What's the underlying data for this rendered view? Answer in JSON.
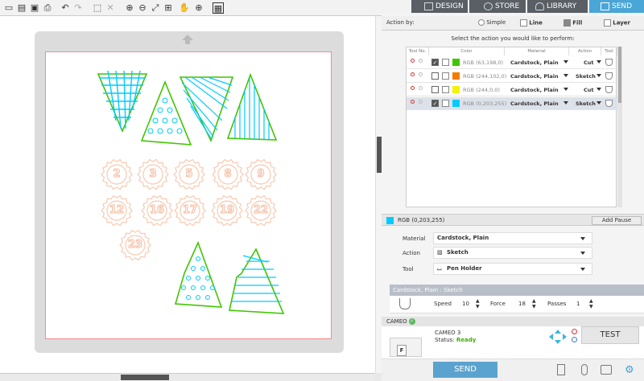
{
  "nav": {
    "design": "DESIGN",
    "store": "STORE",
    "library": "LIBRARY",
    "send": "SEND"
  },
  "action_bar": {
    "label": "Action by:",
    "simple": "Simple",
    "line": "Line",
    "fill": "Fill",
    "layer": "Layer"
  },
  "instruction": "Select the action you would like to perform:",
  "table": {
    "headers": [
      "Tool No.",
      "Color",
      "Material",
      "Action",
      "Tool"
    ],
    "rows": [
      {
        "checked": true,
        "swatch": "#3fc600",
        "color": "RGB (63,198,0)",
        "material": "Cardstock, Plain",
        "action": "Cut",
        "selected": false
      },
      {
        "checked": false,
        "swatch": "#f47a00",
        "color": "RGB (244,102,0)",
        "material": "Cardstock, Plain",
        "action": "Sketch",
        "selected": false
      },
      {
        "checked": false,
        "swatch": "#f4f400",
        "color": "RGB (244,0,0)",
        "material": "Cardstock, Plain",
        "action": "Cut",
        "selected": false
      },
      {
        "checked": true,
        "swatch": "#00cbff",
        "color": "RGB (0,203,255)",
        "material": "Cardstock, Plain",
        "action": "Sketch",
        "selected": true
      }
    ]
  },
  "selected_color": {
    "label": "RGB (0,203,255)",
    "swatch": "#00cbff"
  },
  "add_pause": "Add Pause",
  "props": {
    "material_label": "Material",
    "material": "Cardstock, Plain",
    "action_label": "Action",
    "action": "Sketch",
    "tool_label": "Tool",
    "tool": "Pen Holder"
  },
  "settings": {
    "header": "Cardstock, Plain : Sketch",
    "speed_label": "Speed",
    "speed": "10",
    "force_label": "Force",
    "force": "18",
    "passes_label": "Passes",
    "passes": "1"
  },
  "device": {
    "section": "CAMEO",
    "name": "CAMEO 3",
    "status_label": "Status:",
    "status": "Ready",
    "test": "TEST"
  },
  "send": "SEND",
  "numbers": [
    "2",
    "3",
    "5",
    "8",
    "9",
    "12",
    "16",
    "17",
    "19",
    "22",
    "23"
  ]
}
